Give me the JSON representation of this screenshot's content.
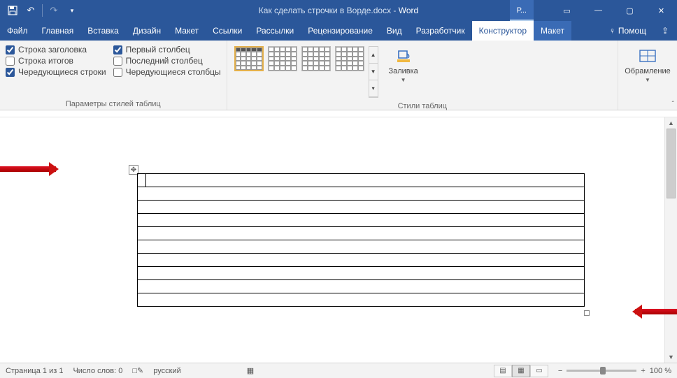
{
  "title": {
    "doc": "Как сделать строчки в Ворде.docx",
    "app": "Word"
  },
  "context_tab_group": "Р...",
  "wincontrols": {
    "min": "—",
    "max": "▢",
    "close": "✕",
    "ribbon_opts": "▭"
  },
  "qat": {
    "save": "💾",
    "undo": "↶",
    "redo": "↷",
    "more": "▾"
  },
  "tabs": {
    "file": "Файл",
    "home": "Главная",
    "insert": "Вставка",
    "design": "Дизайн",
    "layout": "Макет",
    "references": "Ссылки",
    "mailings": "Рассылки",
    "review": "Рецензирование",
    "view": "Вид",
    "developer": "Разработчик",
    "constructor": "Конструктор",
    "tbl_layout": "Макет"
  },
  "help": {
    "bulb": "♀",
    "label": "Помощ",
    "share_icon": "⇪"
  },
  "options_group": {
    "label": "Параметры стилей таблиц",
    "header_row": "Строка заголовка",
    "total_row": "Строка итогов",
    "banded_rows": "Чередующиеся строки",
    "first_col": "Первый столбец",
    "last_col": "Последний столбец",
    "banded_cols": "Чередующиеся столбцы"
  },
  "styles_group": {
    "label": "Стили таблиц",
    "shading": "Заливка",
    "borders": "Обрамление"
  },
  "status": {
    "page": "Страница 1 из 1",
    "words": "Число слов: 0",
    "lang": "русский",
    "zoom": "100 %"
  }
}
